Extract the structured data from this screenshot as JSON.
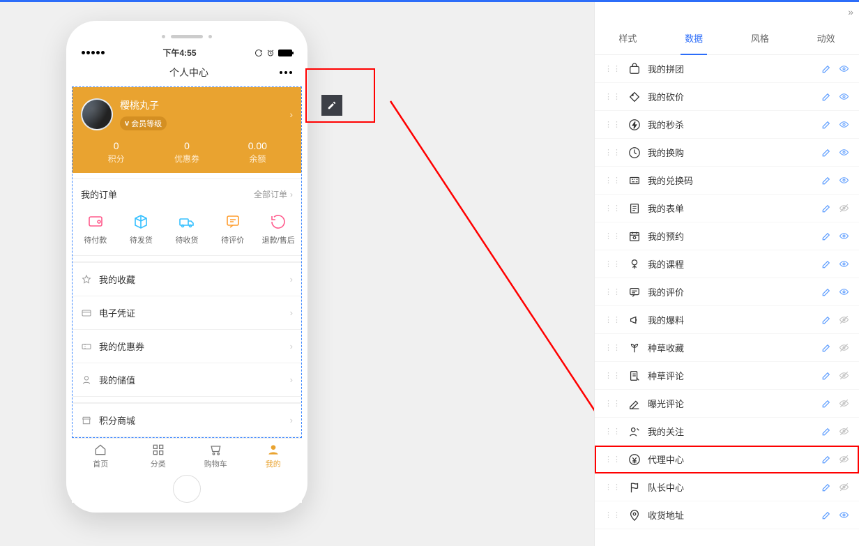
{
  "statusbar": {
    "time": "下午4:55"
  },
  "navbar": {
    "title": "个人中心"
  },
  "profile": {
    "name": "樱桃丸子",
    "badge": "会员等级",
    "stats": [
      {
        "value": "0",
        "label": "积分"
      },
      {
        "value": "0",
        "label": "优惠券"
      },
      {
        "value": "0.00",
        "label": "余额"
      }
    ]
  },
  "orders": {
    "title": "我的订单",
    "more": "全部订单",
    "items": [
      {
        "label": "待付款"
      },
      {
        "label": "待发货"
      },
      {
        "label": "待收货"
      },
      {
        "label": "待评价"
      },
      {
        "label": "退款/售后"
      }
    ]
  },
  "menu": [
    {
      "label": "我的收藏"
    },
    {
      "label": "电子凭证"
    },
    {
      "label": "我的优惠券"
    },
    {
      "label": "我的储值"
    }
  ],
  "mall": {
    "label": "积分商城"
  },
  "tabbar": [
    {
      "label": "首页"
    },
    {
      "label": "分类"
    },
    {
      "label": "购物车"
    },
    {
      "label": "我的"
    }
  ],
  "panel": {
    "tabs": [
      {
        "label": "样式"
      },
      {
        "label": "数据"
      },
      {
        "label": "风格"
      },
      {
        "label": "动效"
      }
    ],
    "active_tab": 1,
    "items": [
      {
        "label": "我的拼团",
        "visible": true
      },
      {
        "label": "我的砍价",
        "visible": true
      },
      {
        "label": "我的秒杀",
        "visible": true
      },
      {
        "label": "我的换购",
        "visible": true
      },
      {
        "label": "我的兑换码",
        "visible": true
      },
      {
        "label": "我的表单",
        "visible": false
      },
      {
        "label": "我的预约",
        "visible": true
      },
      {
        "label": "我的课程",
        "visible": true
      },
      {
        "label": "我的评价",
        "visible": true
      },
      {
        "label": "我的爆料",
        "visible": false
      },
      {
        "label": "种草收藏",
        "visible": false
      },
      {
        "label": "种草评论",
        "visible": false
      },
      {
        "label": "曝光评论",
        "visible": false
      },
      {
        "label": "我的关注",
        "visible": false
      },
      {
        "label": "代理中心",
        "visible": false,
        "highlight": true
      },
      {
        "label": "队长中心",
        "visible": false
      },
      {
        "label": "收货地址",
        "visible": true
      }
    ]
  },
  "colors": {
    "accent": "#e9a330",
    "primary": "#2c6df9",
    "red": "#ff0000"
  }
}
